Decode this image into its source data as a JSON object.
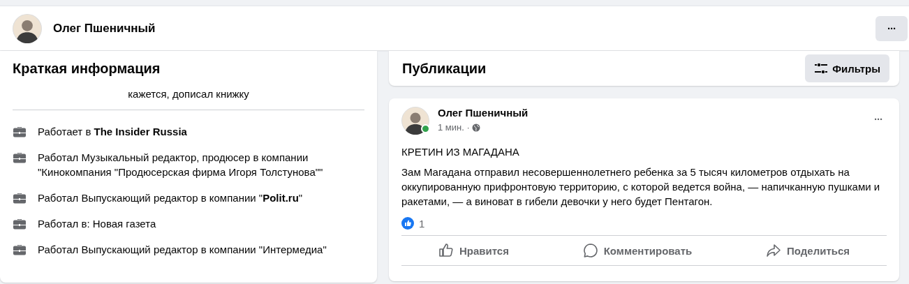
{
  "profile_header": {
    "name": "Олег Пшеничный",
    "more_button": "···"
  },
  "intro": {
    "title": "Краткая информация",
    "bio": "кажется, дописал книжку",
    "items": [
      {
        "text": "Работает в **The Insider Russia**"
      },
      {
        "text": "Работал Музыкальный редактор, продюсер в компании \"Кинокомпания \"Продюсерская фирма Игоря Толстунова\"\""
      },
      {
        "text": "Работал Выпускающий редактор в компании \"**Polit.ru**\""
      },
      {
        "text": "Работал в: Новая газета"
      },
      {
        "text": "Работал Выпускающий редактор в компании \"Интермедиа\""
      }
    ]
  },
  "posts_header": {
    "title": "Публикации",
    "filter_button": "Фильтры"
  },
  "post": {
    "author": "Олег Пшеничный",
    "online": true,
    "time": "1 мин. ·",
    "more_button": "···",
    "title": "КРЕТИН ИЗ МАГАДАНА",
    "body": "Зам Магадана отправил несовершеннолетнего ребенка за 5 тысяч километров отдыхать на оккупированную прифронтовую территорию, с которой ведется война, — напичканную пушками и ракетами, — а виноват в гибели девочки у него будет Пентагон.",
    "like_count": "1",
    "actions": [
      {
        "kind": "like",
        "label": "Нравится"
      },
      {
        "kind": "comment",
        "label": "Комментировать"
      },
      {
        "kind": "share",
        "label": "Поделиться"
      }
    ]
  }
}
